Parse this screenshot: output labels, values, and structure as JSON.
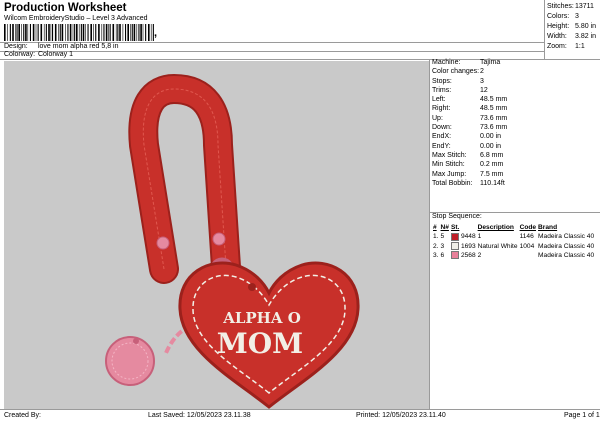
{
  "header": {
    "title": "Production Worksheet",
    "subtitle": "Wilcom EmbroideryStudio – Level 3 Advanced",
    "barcode_tail": ",",
    "design_label": "Design:",
    "design_value": "love mom alpha red 5,8 in",
    "colorway_label": "Colorway:",
    "colorway_value": "Colorway 1"
  },
  "stats": [
    {
      "label": "Stitches:",
      "value": "13711"
    },
    {
      "label": "Colors:",
      "value": "3"
    },
    {
      "label": "Height:",
      "value": "5.80 in"
    },
    {
      "label": "Width:",
      "value": "3.82 in"
    },
    {
      "label": "Zoom:",
      "value": "1:1"
    }
  ],
  "design": {
    "text_line1": "ALPHA O",
    "text_line2": "MOM",
    "colors": {
      "background": "#c9c9c9",
      "red": "#c8302a",
      "red_dark": "#9c211c",
      "pink": "#e58aa0",
      "pink_dark": "#c7607a",
      "white": "#f2efe6"
    }
  },
  "specs": [
    {
      "label": "Machine:",
      "value": "Tajima"
    },
    {
      "label": "Color changes:",
      "value": "2"
    },
    {
      "label": "Stops:",
      "value": "3"
    },
    {
      "label": "Trims:",
      "value": "12"
    },
    {
      "label": "Left:",
      "value": "48.5 mm"
    },
    {
      "label": "Right:",
      "value": "48.5 mm"
    },
    {
      "label": "Up:",
      "value": "73.6 mm"
    },
    {
      "label": "Down:",
      "value": "73.6 mm"
    },
    {
      "label": "EndX:",
      "value": "0.00 in"
    },
    {
      "label": "EndY:",
      "value": "0.00 in"
    },
    {
      "label": "Max Stitch:",
      "value": "6.8 mm"
    },
    {
      "label": "Min Stitch:",
      "value": "0.2 mm"
    },
    {
      "label": "Max Jump:",
      "value": "7.5 mm"
    },
    {
      "label": "Total Bobbin:",
      "value": "110.14ft"
    }
  ],
  "stop_sequence": {
    "label": "Stop Sequence:",
    "columns": [
      "#",
      "N#",
      "St.",
      "Description",
      "Code",
      "Brand"
    ],
    "rows": [
      {
        "num": "1.",
        "n": "5",
        "color": "#c0202a",
        "st": "9448",
        "desc": "1",
        "code": "1146",
        "brand": "Madeira Classic 40"
      },
      {
        "num": "2.",
        "n": "3",
        "color": "#f0efe8",
        "st": "1693",
        "desc": "Natural White",
        "code": "1004",
        "brand": "Madeira Classic 40"
      },
      {
        "num": "3.",
        "n": "6",
        "color": "#e8809a",
        "st": "2568",
        "desc": "2",
        "code": "",
        "brand": "Madeira Classic 40"
      }
    ]
  },
  "footer": {
    "created_by": "Created By:",
    "last_saved": "Last Saved: 12/05/2023 23.11.38",
    "printed": "Printed: 12/05/2023 23.11.40",
    "page": "Page 1 of 1"
  }
}
